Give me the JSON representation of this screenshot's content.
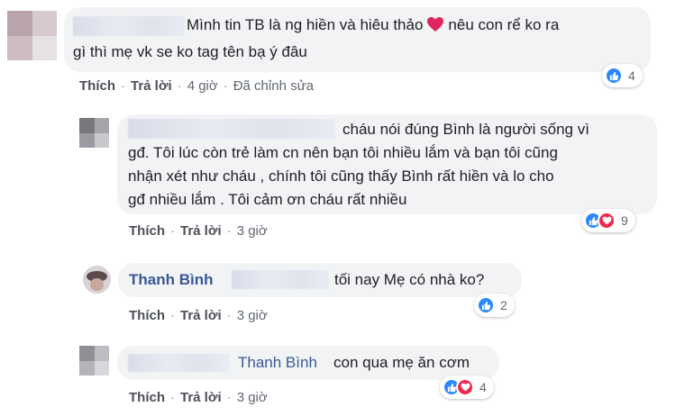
{
  "comments": [
    {
      "text_line1": "Mình tin TB là ng hiền và hiêu thảo",
      "text_line1_tail": "nêu con rể ko ra",
      "text_line2": "gì thì mẹ vk se ko tag tên bạ ý đâu",
      "actions": {
        "like": "Thích",
        "reply": "Trả lời",
        "time": "4 giờ",
        "edited": "Đã chỉnh sửa"
      },
      "reaction_count": "4",
      "reaction_icons": [
        "like-icon"
      ]
    },
    {
      "text_line1": "cháu nói đúng Bình là người sống vì",
      "text_line2": "gđ. Tôi lúc còn trẻ làm cn nên bạn tôi nhiều lắm và bạn tôi cũng",
      "text_line3": "nhận xét như cháu , chính tôi cũng thấy Bình rất hiền và lo cho",
      "text_line4": "gđ nhiều lắm . Tôi cảm ơn cháu rất nhiều",
      "actions": {
        "like": "Thích",
        "reply": "Trả lời",
        "time": "3 giờ"
      },
      "reaction_count": "9",
      "reaction_icons": [
        "like-icon",
        "love-icon"
      ]
    },
    {
      "author": "Thanh Bình",
      "text": "tối nay Mẹ có nhà ko?",
      "actions": {
        "like": "Thích",
        "reply": "Trả lời",
        "time": "3 giờ"
      },
      "reaction_count": "2",
      "reaction_icons": [
        "like-icon"
      ]
    },
    {
      "tag": "Thanh Bình",
      "text": "con qua mẹ ăn cơm",
      "actions": {
        "like": "Thích",
        "reply": "Trả lời",
        "time": "3 giờ"
      },
      "reaction_count": "4",
      "reaction_icons": [
        "like-icon",
        "love-icon"
      ]
    }
  ],
  "colors": {
    "link": "#385898",
    "bubble": "#f2f3f5",
    "like": "#2d88ff",
    "love": "#f0284a",
    "heart_emoji": "#e0245e"
  }
}
